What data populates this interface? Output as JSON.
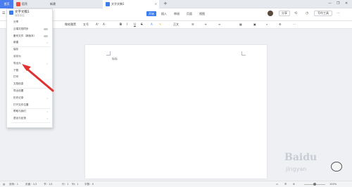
{
  "tabs": {
    "home": "首页",
    "wps_label": "稻壳",
    "t2": "新建",
    "doc": "文字文稿1",
    "plus": "+"
  },
  "header": {
    "ribbon": [
      "开始",
      "插入",
      "审阅",
      "页面",
      "视图"
    ],
    "share_btn": "分享",
    "collab_btn": "写作工具",
    "window_controls": [
      "—",
      "❐",
      "✕"
    ]
  },
  "format_toolbar": {
    "style_select": "微软雅黑",
    "size_select": "五号",
    "bold": "B",
    "italic": "I",
    "underline": "U",
    "strike": "S",
    "list_btn": "正文"
  },
  "document": {
    "placeholder": "标标"
  },
  "menu": {
    "title": "文字文稿1",
    "subtitle": "保存到云",
    "items": [
      {
        "label": "分享",
        "y": 2
      },
      {
        "label": "云端文档同步",
        "control": "toggle"
      },
      {
        "label": "备份文件（新版本）",
        "control": "toggle"
      },
      {
        "label": "新建",
        "control": "chevron"
      },
      {
        "label": "保存"
      },
      {
        "label": "另存为"
      },
      {
        "label": "导出为",
        "control": "chevron"
      },
      {
        "label": "下载"
      },
      {
        "label": "打印"
      },
      {
        "label": "文档信息"
      },
      {
        "label": "导出设置"
      },
      {
        "label": "历史记录",
        "control": "chevron"
      },
      {
        "label": "打开文件位置"
      },
      {
        "label": "帮助与我们",
        "control": "chevron"
      },
      {
        "label": "退出与反馈",
        "control": "chevron"
      }
    ]
  },
  "statusbar": {
    "page": "页码：1",
    "pages": "页面：1/1",
    "section": "节：1/1",
    "row": "行：1",
    "col": "列：1",
    "words": "字数：0",
    "zoom": "100%"
  },
  "watermark": {
    "text": "Baidu",
    "sub": "jingyan"
  },
  "colors": {
    "accent": "#3b7ded",
    "arrow": "#e03131"
  }
}
